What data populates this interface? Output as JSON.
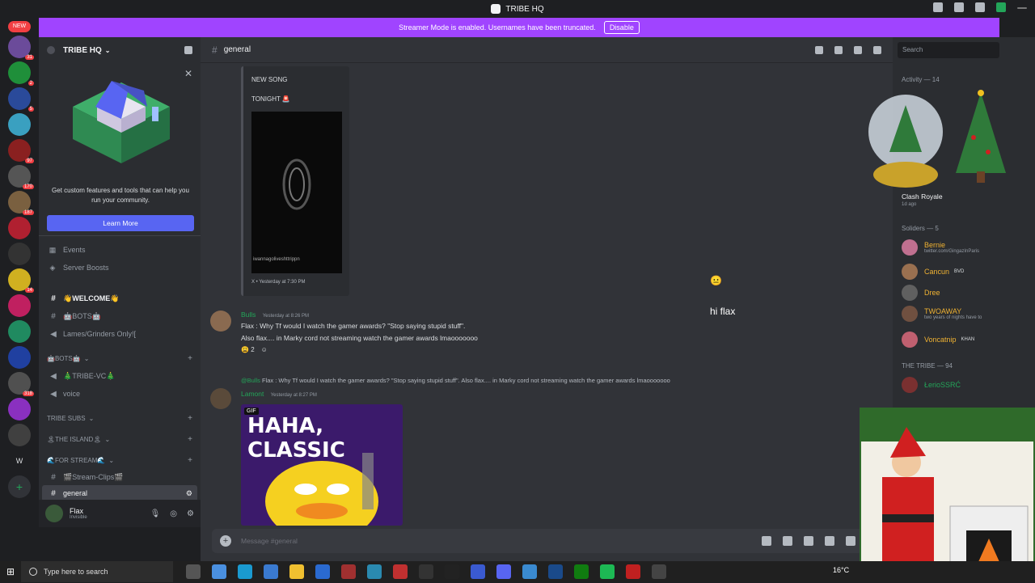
{
  "window": {
    "title": "TRIBE HQ"
  },
  "banner": {
    "text": "Streamer Mode is enabled. Usernames have been truncated.",
    "button": "Disable"
  },
  "servers": {
    "new_label": "NEW",
    "badges": [
      "31",
      "2",
      "5",
      "97",
      "170",
      "187",
      "14",
      "318"
    ],
    "letter": "W"
  },
  "guild": {
    "name": "TRIBE HQ"
  },
  "promo": {
    "text": "Get custom features and tools that can help you run your community.",
    "button": "Learn More"
  },
  "nav": {
    "events": "Events",
    "boosts": "Server Boosts"
  },
  "channels": {
    "welcome": "👋WELCOME👋",
    "bots": "🤖BOTS🤖",
    "lames": "Lames/Grinders Only![",
    "cat_bots": "🤖BOTS🤖",
    "tribe_vc": "🎄TRIBE-VC🎄",
    "voice": "voice",
    "cat_subs": "TRIBE SUBS",
    "cat_island": "🏝THE ISLAND🏝",
    "cat_stream": "🌊FOR STREAM🌊",
    "stream_clips": "🎬Stream-Clips🎬",
    "general": "general"
  },
  "user": {
    "name": "Flax",
    "status": "Invisible"
  },
  "header": {
    "channel": "general"
  },
  "embed": {
    "line1": "NEW SONG",
    "line2": "TONIGHT 🚨",
    "caption": "iwannagoliveshttrippn",
    "footer": "X • Yesterday at 7:30 PM"
  },
  "messages": [
    {
      "author": "Bulls",
      "time": "Yesterday at 8:26 PM",
      "lines": [
        "Flax : Why Tf would I watch the gamer awards? \"Stop saying stupid stuff\".",
        "Also flax.... in Marky cord not streaming watch the gamer awards lmaooooooo"
      ],
      "reaction": "😩",
      "reaction_count": "2"
    },
    {
      "reply_to": "@Bulls",
      "reply_text": "Flax : Why Tf would I watch the gamer awards? \"Stop saying stupid stuff\".  Also flax.... in Marky cord not streaming watch the gamer awards lmaooooooo",
      "author": "Lamont",
      "time": "Yesterday at 8:27 PM",
      "gif_label": "GIF",
      "gif_text": "HAHA, CLASSIC"
    }
  ],
  "composer": {
    "placeholder": "Message #general"
  },
  "overlay": {
    "text": "hi flax"
  },
  "members": {
    "search_placeholder": "Search",
    "activity_header": "Activity — 14",
    "activity_game": "Clash Royale",
    "activity_time": "1d ago",
    "soldiers_header": "Soliders — 5",
    "soldiers": [
      {
        "name": "Bernie",
        "sub": "twitter.com/GingazInParis",
        "color": "#f0b232"
      },
      {
        "name": "Cancun",
        "sub": "",
        "tag": "BVD",
        "color": "#f0b232"
      },
      {
        "name": "Dree",
        "sub": "",
        "color": "#f0b232"
      },
      {
        "name": "TWOAWAY",
        "sub": "two years of nights have to",
        "color": "#f0b232"
      },
      {
        "name": "Voncatnip",
        "sub": "",
        "tag": "KHAN",
        "color": "#f0b232"
      }
    ],
    "tribe_header": "THE TRIBE — 94",
    "tribe": [
      {
        "name": "ŁerioSSRĆ",
        "color": "#23a559"
      }
    ]
  },
  "taskbar": {
    "search_placeholder": "Type here to search",
    "temp": "16°C"
  }
}
